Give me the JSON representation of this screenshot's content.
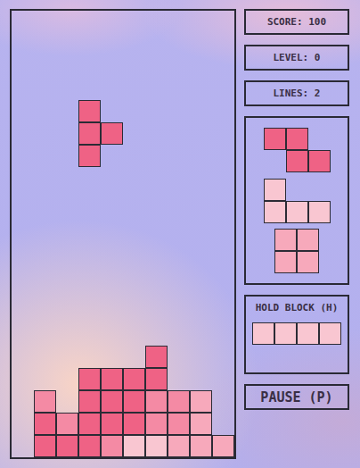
{
  "stats": [
    {
      "label": "SCORE: 100"
    },
    {
      "label": "LEVEL: 0"
    },
    {
      "label": "LINES: 2"
    }
  ],
  "palette": {
    "a": "#ef6285",
    "b": "#f48aa4",
    "c": "#f7a9bb",
    "d": "#f9c6d1"
  },
  "board": {
    "rows": [
      "..........",
      "..........",
      "..........",
      "..........",
      "...a......",
      "...aa.....",
      "...a......",
      "..........",
      "..........",
      "..........",
      "..........",
      "..........",
      "..........",
      "..........",
      "..........",
      "......a...",
      "...aaaa...",
      ".b.aaabbc.",
      ".abaaabbc.",
      ".aaabddccc"
    ]
  },
  "next": [
    {
      "shape": [
        [
          1,
          1,
          0
        ],
        [
          0,
          1,
          1
        ]
      ],
      "color": "#ef6285"
    },
    {
      "shape": [
        [
          1,
          0,
          0
        ],
        [
          1,
          1,
          1
        ]
      ],
      "color": "#f9c6d1"
    },
    {
      "shape": [
        [
          1,
          1
        ],
        [
          1,
          1
        ]
      ],
      "color": "#f7a9bb"
    }
  ],
  "hold": {
    "label": "HOLD BLOCK (H)",
    "piece": {
      "shape": [
        [
          1,
          1,
          1,
          1
        ]
      ],
      "color": "#f9c6d1"
    }
  },
  "pause": {
    "label": "PAUSE (P)"
  }
}
